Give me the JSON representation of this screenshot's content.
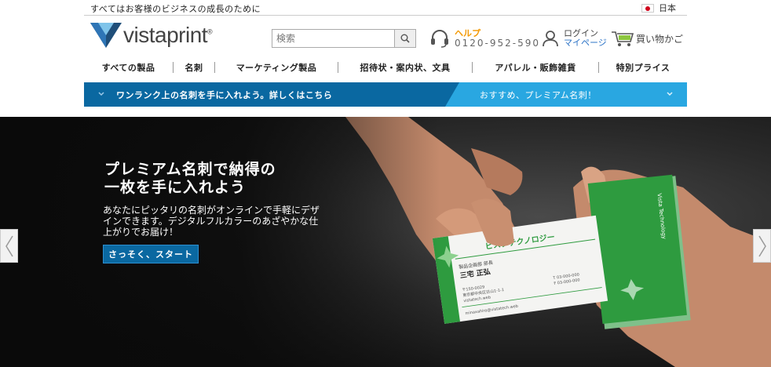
{
  "topbar": {
    "tagline": "すべてはお客様のビジネスの成長のために",
    "language": "日本"
  },
  "header": {
    "logo_text": "vistaprint",
    "search": {
      "placeholder": "検索",
      "value": ""
    },
    "help": {
      "label": "ヘルプ",
      "phone": "0120-952-590"
    },
    "account": {
      "login": "ログイン",
      "mypage": "マイページ"
    },
    "cart_label": "買い物かご"
  },
  "nav": {
    "items": [
      {
        "label": "すべての製品"
      },
      {
        "label": "名刺"
      },
      {
        "label": "マーケティング製品"
      },
      {
        "label": "招待状・案内状、文具"
      },
      {
        "label": "アパレル・販飾雑貨"
      },
      {
        "label": "特別プライス"
      }
    ]
  },
  "promo": {
    "left_text": "ワンランク上の名刺を手に入れよう。詳しくはこちら",
    "right_text": "おすすめ、プレミアム名刺！"
  },
  "hero": {
    "headline_line1": "プレミアム名刺で納得の",
    "headline_line2": "一枚を手に入れよう",
    "body": "あなたにピッタリの名刺がオンラインで手軽にデザインできます。デジタルフルカラーのあざやかな仕上がりでお届け！",
    "cta": "さっそく、スタート",
    "card": {
      "company": "ビスタテクノロジー",
      "dept": "製品企画部 部長",
      "name": "三宅 正弘",
      "postal": "〒150-0029",
      "address": "東京都中央区日山1-1-1",
      "web": "vistatech.web",
      "phone1": "T 03-000-000",
      "phone2": "F 03-000-000",
      "email": "minaxahiro@vistatech.web",
      "back_text": "Vista Technology"
    }
  },
  "colors": {
    "brand_blue": "#0a68a1",
    "accent_light_blue": "#29a7e1",
    "help_orange": "#f39800",
    "card_green": "#2e9b3f"
  }
}
